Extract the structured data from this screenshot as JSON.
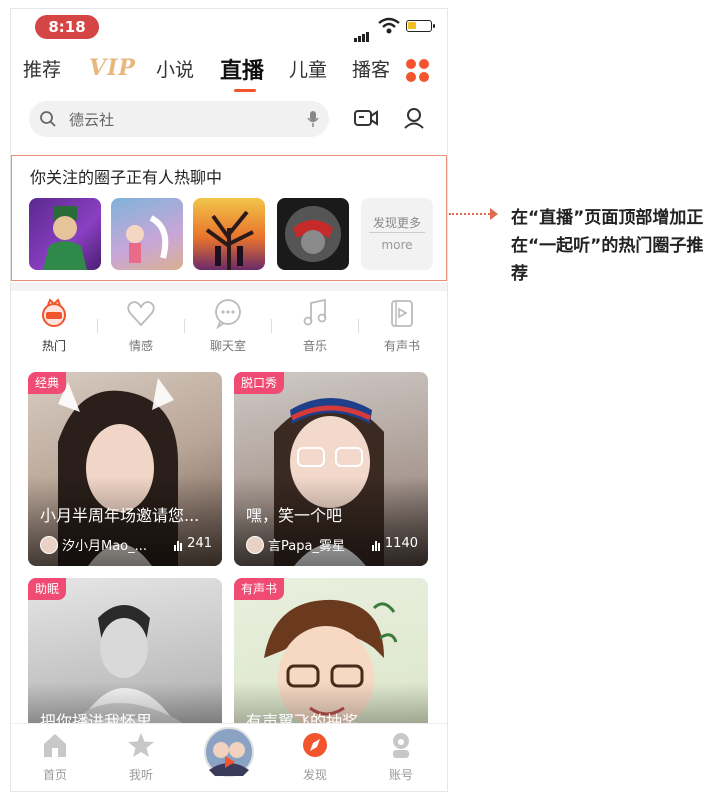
{
  "status_bar": {
    "time": "8:18"
  },
  "top_nav": {
    "tabs": [
      {
        "label": "推荐"
      },
      {
        "label": "VIP"
      },
      {
        "label": "小说"
      },
      {
        "label": "直播",
        "active": true
      },
      {
        "label": "儿童"
      },
      {
        "label": "播客"
      }
    ]
  },
  "search": {
    "placeholder": "德云社"
  },
  "circles": {
    "title": "你关注的圈子正有人热聊中",
    "more_label": "发现更多",
    "more_sub": "more"
  },
  "categories": [
    {
      "label": "热门",
      "icon": "hot-icon",
      "active": true
    },
    {
      "label": "情感",
      "icon": "heart-icon"
    },
    {
      "label": "聊天室",
      "icon": "chat-icon"
    },
    {
      "label": "音乐",
      "icon": "music-note-icon"
    },
    {
      "label": "有声书",
      "icon": "audiobook-icon"
    }
  ],
  "cards": [
    {
      "tag": "经典",
      "title": "小月半周年场邀请您...",
      "host": "汐小月Mao_...",
      "listeners": "241"
    },
    {
      "tag": "脱口秀",
      "title": "嘿，笑一个吧",
      "host": "言Papa_雾星",
      "listeners": "1140"
    },
    {
      "tag": "助眠",
      "title": "把你播进我怀里"
    },
    {
      "tag": "有声书",
      "title": "有声翼飞的抽奖"
    }
  ],
  "bottom_nav": [
    {
      "label": "首页",
      "icon": "home-icon"
    },
    {
      "label": "我听",
      "icon": "star-icon"
    },
    {
      "label": "",
      "icon": "now-playing-avatar"
    },
    {
      "label": "发现",
      "icon": "compass-icon",
      "active": true
    },
    {
      "label": "账号",
      "icon": "account-icon"
    }
  ],
  "annotation": {
    "text": "在“直播”页面顶部增加正在“一起听”的热门圈子推荐"
  },
  "colors": {
    "accent": "#f2542d",
    "badge": "#ef4b73",
    "annotation": "#e06b51"
  }
}
